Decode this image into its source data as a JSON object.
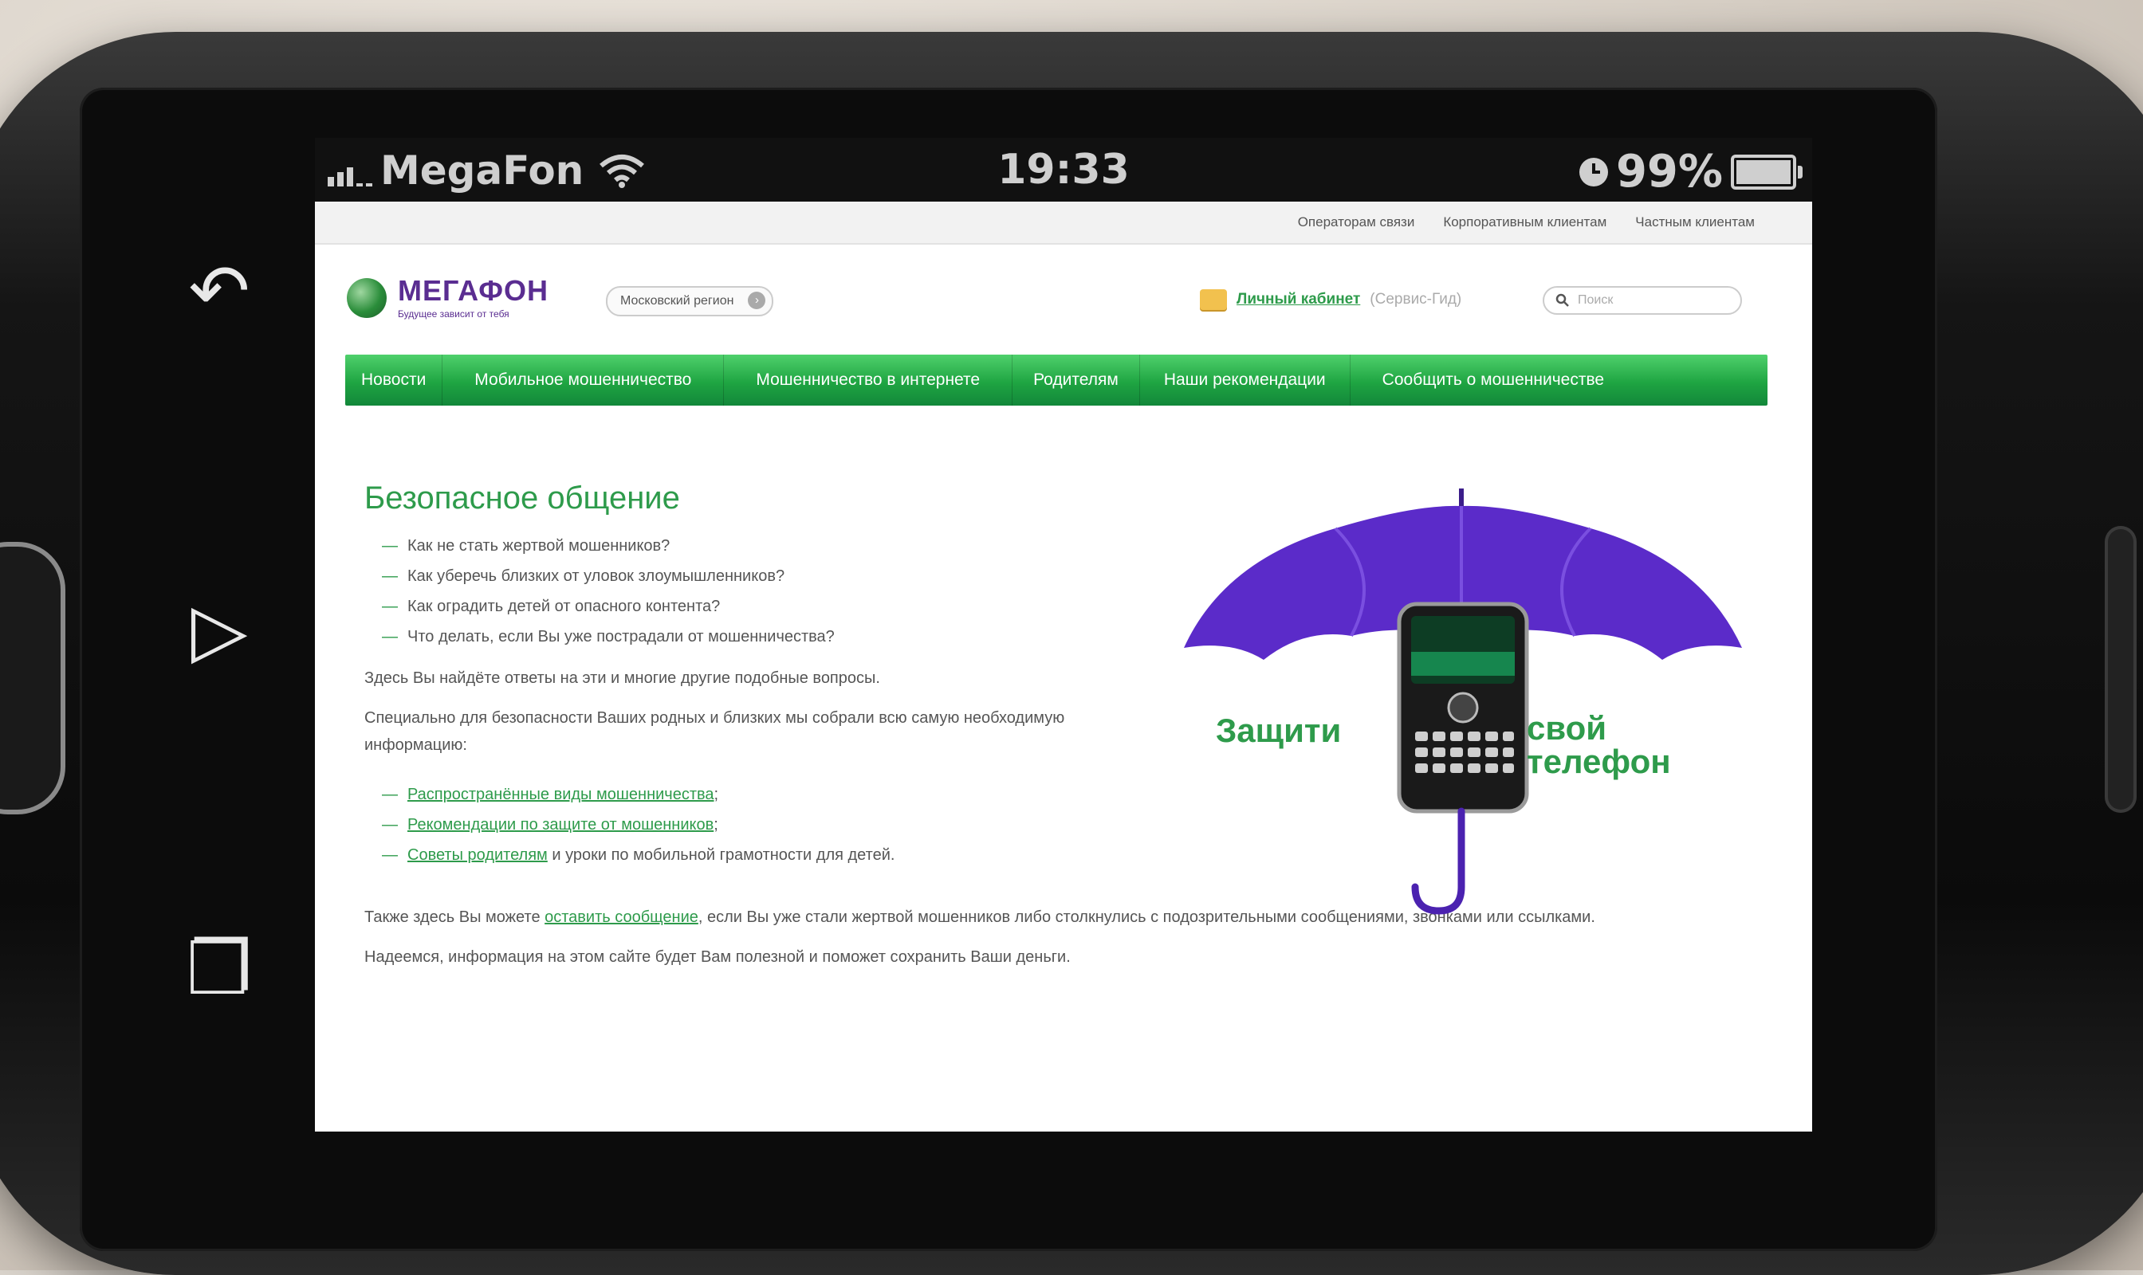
{
  "statusbar": {
    "carrier": "MegaFon",
    "time": "19:33",
    "battery": "99%"
  },
  "topbar": {
    "links": [
      "Операторам связи",
      "Корпоративным клиентам",
      "Частным клиентам"
    ]
  },
  "header": {
    "logo_text": "МЕГАФОН",
    "logo_tagline": "Будущее зависит от тебя",
    "region": "Московский регион",
    "cabinet_link": "Личный кабинет",
    "cabinet_note": "(Сервис-Гид)",
    "search_placeholder": "Поиск"
  },
  "nav": [
    "Новости",
    "Мобильное мошенничество",
    "Мошенничество в интернете",
    "Родителям",
    "Наши рекомендации",
    "Сообщить о мошенничестве"
  ],
  "content": {
    "title": "Безопасное общение",
    "questions": [
      "Как не стать жертвой мошенников?",
      "Как уберечь близких от уловок злоумышленников?",
      "Как оградить детей от опасного контента?",
      "Что делать, если Вы уже пострадали от мошенничества?"
    ],
    "p1": "Здесь Вы найдёте ответы на эти и многие другие подобные вопросы.",
    "p2": "Специально для безопасности Ваших родных и близких мы собрали всю самую необходимую информацию:",
    "links": [
      {
        "link": "Распространённые виды мошенничества",
        "rest": ";"
      },
      {
        "link": "Рекомендации по защите от мошенников",
        "rest": ";"
      },
      {
        "link": "Советы родителям",
        "rest": " и уроки по мобильной грамотности для детей."
      }
    ],
    "p3_pre": "Также здесь Вы можете ",
    "p3_link": "оставить сообщение",
    "p3_post": ", если Вы уже стали жертвой мошенников либо столкнулись с подозрительными сообщениями, звонками или ссылками.",
    "p4": "Надеемся, информация на этом сайте будет Вам полезной и поможет сохранить Ваши деньги."
  },
  "promo": {
    "left": "Защити",
    "right1": "свой",
    "right2": "телефон"
  },
  "colors": {
    "brand_green": "#2e9b4b",
    "brand_purple": "#5a2d91",
    "umbrella": "#5b2bc9"
  }
}
